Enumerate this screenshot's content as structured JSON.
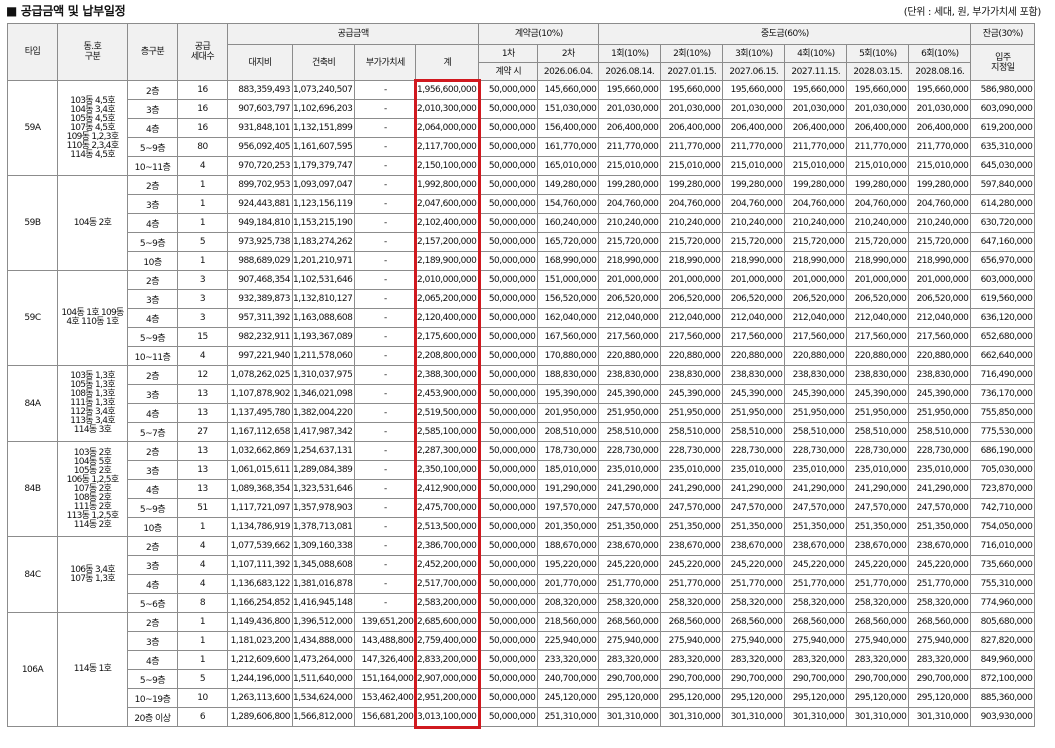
{
  "title": "■ 공급금액 및 납부일정",
  "unit_note": "(단위 : 세대, 원, 부가가치세 포함)",
  "headers": {
    "type": "타입",
    "dong": "동.호\n구분",
    "floor": "층구분",
    "units": "공급\n세대수",
    "supply": "공급금액",
    "land": "대지비",
    "building": "건축비",
    "vat": "부가가치세",
    "total": "계",
    "contract": "계약금(10%)",
    "c1": "1차",
    "c2": "2차",
    "c1_date": "계약 시",
    "c2_date": "2026.06.04.",
    "interim": "중도금(60%)",
    "interim_labels": [
      "1회(10%)",
      "2회(10%)",
      "3회(10%)",
      "4회(10%)",
      "5회(10%)",
      "6회(10%)"
    ],
    "interim_dates": [
      "2026.08.14.",
      "2027.01.15.",
      "2027.06.15.",
      "2027.11.15.",
      "2028.03.15.",
      "2028.08.16."
    ],
    "balance": "잔금(30%)",
    "movein": "입주\n지정일"
  },
  "groups": [
    {
      "type": "59A",
      "dong": "103동 4,5호\n104동 3,4호\n105동 4,5호\n107동 4,5호\n109동 1,2,3호\n110동 2,3,4호\n114동 4,5호",
      "rows": [
        {
          "floor": "2층",
          "units": "16",
          "land": "883,359,493",
          "building": "1,073,240,507",
          "vat": "-",
          "total": "1,956,600,000",
          "c1": "50,000,000",
          "c2": "145,660,000",
          "mid": "195,660,000",
          "bal": "586,980,000"
        },
        {
          "floor": "3층",
          "units": "16",
          "land": "907,603,797",
          "building": "1,102,696,203",
          "vat": "-",
          "total": "2,010,300,000",
          "c1": "50,000,000",
          "c2": "151,030,000",
          "mid": "201,030,000",
          "bal": "603,090,000"
        },
        {
          "floor": "4층",
          "units": "16",
          "land": "931,848,101",
          "building": "1,132,151,899",
          "vat": "-",
          "total": "2,064,000,000",
          "c1": "50,000,000",
          "c2": "156,400,000",
          "mid": "206,400,000",
          "bal": "619,200,000"
        },
        {
          "floor": "5~9층",
          "units": "80",
          "land": "956,092,405",
          "building": "1,161,607,595",
          "vat": "-",
          "total": "2,117,700,000",
          "c1": "50,000,000",
          "c2": "161,770,000",
          "mid": "211,770,000",
          "bal": "635,310,000"
        },
        {
          "floor": "10~11층",
          "units": "4",
          "land": "970,720,253",
          "building": "1,179,379,747",
          "vat": "-",
          "total": "2,150,100,000",
          "c1": "50,000,000",
          "c2": "165,010,000",
          "mid": "215,010,000",
          "bal": "645,030,000"
        }
      ]
    },
    {
      "type": "59B",
      "dong": "104동 2호",
      "rows": [
        {
          "floor": "2층",
          "units": "1",
          "land": "899,702,953",
          "building": "1,093,097,047",
          "vat": "-",
          "total": "1,992,800,000",
          "c1": "50,000,000",
          "c2": "149,280,000",
          "mid": "199,280,000",
          "bal": "597,840,000"
        },
        {
          "floor": "3층",
          "units": "1",
          "land": "924,443,881",
          "building": "1,123,156,119",
          "vat": "-",
          "total": "2,047,600,000",
          "c1": "50,000,000",
          "c2": "154,760,000",
          "mid": "204,760,000",
          "bal": "614,280,000"
        },
        {
          "floor": "4층",
          "units": "1",
          "land": "949,184,810",
          "building": "1,153,215,190",
          "vat": "-",
          "total": "2,102,400,000",
          "c1": "50,000,000",
          "c2": "160,240,000",
          "mid": "210,240,000",
          "bal": "630,720,000"
        },
        {
          "floor": "5~9층",
          "units": "5",
          "land": "973,925,738",
          "building": "1,183,274,262",
          "vat": "-",
          "total": "2,157,200,000",
          "c1": "50,000,000",
          "c2": "165,720,000",
          "mid": "215,720,000",
          "bal": "647,160,000"
        },
        {
          "floor": "10층",
          "units": "1",
          "land": "988,689,029",
          "building": "1,201,210,971",
          "vat": "-",
          "total": "2,189,900,000",
          "c1": "50,000,000",
          "c2": "168,990,000",
          "mid": "218,990,000",
          "bal": "656,970,000"
        }
      ]
    },
    {
      "type": "59C",
      "dong": "104동 1호 109동\n4호 110동 1호",
      "rows": [
        {
          "floor": "2층",
          "units": "3",
          "land": "907,468,354",
          "building": "1,102,531,646",
          "vat": "-",
          "total": "2,010,000,000",
          "c1": "50,000,000",
          "c2": "151,000,000",
          "mid": "201,000,000",
          "bal": "603,000,000"
        },
        {
          "floor": "3층",
          "units": "3",
          "land": "932,389,873",
          "building": "1,132,810,127",
          "vat": "-",
          "total": "2,065,200,000",
          "c1": "50,000,000",
          "c2": "156,520,000",
          "mid": "206,520,000",
          "bal": "619,560,000"
        },
        {
          "floor": "4층",
          "units": "3",
          "land": "957,311,392",
          "building": "1,163,088,608",
          "vat": "-",
          "total": "2,120,400,000",
          "c1": "50,000,000",
          "c2": "162,040,000",
          "mid": "212,040,000",
          "bal": "636,120,000"
        },
        {
          "floor": "5~9층",
          "units": "15",
          "land": "982,232,911",
          "building": "1,193,367,089",
          "vat": "-",
          "total": "2,175,600,000",
          "c1": "50,000,000",
          "c2": "167,560,000",
          "mid": "217,560,000",
          "bal": "652,680,000"
        },
        {
          "floor": "10~11층",
          "units": "4",
          "land": "997,221,940",
          "building": "1,211,578,060",
          "vat": "-",
          "total": "2,208,800,000",
          "c1": "50,000,000",
          "c2": "170,880,000",
          "mid": "220,880,000",
          "bal": "662,640,000"
        }
      ]
    },
    {
      "type": "84A",
      "dong": "103동 1,3호\n105동 1,3호\n108동 1,3호\n111동 1,3호\n112동 3,4호\n113동 3,4호\n114동 3호",
      "rows": [
        {
          "floor": "2층",
          "units": "12",
          "land": "1,078,262,025",
          "building": "1,310,037,975",
          "vat": "-",
          "total": "2,388,300,000",
          "c1": "50,000,000",
          "c2": "188,830,000",
          "mid": "238,830,000",
          "bal": "716,490,000"
        },
        {
          "floor": "3층",
          "units": "13",
          "land": "1,107,878,902",
          "building": "1,346,021,098",
          "vat": "-",
          "total": "2,453,900,000",
          "c1": "50,000,000",
          "c2": "195,390,000",
          "mid": "245,390,000",
          "bal": "736,170,000"
        },
        {
          "floor": "4층",
          "units": "13",
          "land": "1,137,495,780",
          "building": "1,382,004,220",
          "vat": "-",
          "total": "2,519,500,000",
          "c1": "50,000,000",
          "c2": "201,950,000",
          "mid": "251,950,000",
          "bal": "755,850,000"
        },
        {
          "floor": "5~7층",
          "units": "27",
          "land": "1,167,112,658",
          "building": "1,417,987,342",
          "vat": "-",
          "total": "2,585,100,000",
          "c1": "50,000,000",
          "c2": "208,510,000",
          "mid": "258,510,000",
          "bal": "775,530,000"
        }
      ]
    },
    {
      "type": "84B",
      "dong": "103동 2호\n104동 5호\n105동 2호\n106동 1,2,5호\n107동 2호\n108동 2호\n111동 2호\n113동 1,2,5호\n114동 2호",
      "rows": [
        {
          "floor": "2층",
          "units": "13",
          "land": "1,032,662,869",
          "building": "1,254,637,131",
          "vat": "-",
          "total": "2,287,300,000",
          "c1": "50,000,000",
          "c2": "178,730,000",
          "mid": "228,730,000",
          "bal": "686,190,000"
        },
        {
          "floor": "3층",
          "units": "13",
          "land": "1,061,015,611",
          "building": "1,289,084,389",
          "vat": "-",
          "total": "2,350,100,000",
          "c1": "50,000,000",
          "c2": "185,010,000",
          "mid": "235,010,000",
          "bal": "705,030,000"
        },
        {
          "floor": "4층",
          "units": "13",
          "land": "1,089,368,354",
          "building": "1,323,531,646",
          "vat": "-",
          "total": "2,412,900,000",
          "c1": "50,000,000",
          "c2": "191,290,000",
          "mid": "241,290,000",
          "bal": "723,870,000"
        },
        {
          "floor": "5~9층",
          "units": "51",
          "land": "1,117,721,097",
          "building": "1,357,978,903",
          "vat": "-",
          "total": "2,475,700,000",
          "c1": "50,000,000",
          "c2": "197,570,000",
          "mid": "247,570,000",
          "bal": "742,710,000"
        },
        {
          "floor": "10층",
          "units": "1",
          "land": "1,134,786,919",
          "building": "1,378,713,081",
          "vat": "-",
          "total": "2,513,500,000",
          "c1": "50,000,000",
          "c2": "201,350,000",
          "mid": "251,350,000",
          "bal": "754,050,000"
        }
      ]
    },
    {
      "type": "84C",
      "dong": "106동 3,4호\n107동 1,3호",
      "rows": [
        {
          "floor": "2층",
          "units": "4",
          "land": "1,077,539,662",
          "building": "1,309,160,338",
          "vat": "-",
          "total": "2,386,700,000",
          "c1": "50,000,000",
          "c2": "188,670,000",
          "mid": "238,670,000",
          "bal": "716,010,000"
        },
        {
          "floor": "3층",
          "units": "4",
          "land": "1,107,111,392",
          "building": "1,345,088,608",
          "vat": "-",
          "total": "2,452,200,000",
          "c1": "50,000,000",
          "c2": "195,220,000",
          "mid": "245,220,000",
          "bal": "735,660,000"
        },
        {
          "floor": "4층",
          "units": "4",
          "land": "1,136,683,122",
          "building": "1,381,016,878",
          "vat": "-",
          "total": "2,517,700,000",
          "c1": "50,000,000",
          "c2": "201,770,000",
          "mid": "251,770,000",
          "bal": "755,310,000"
        },
        {
          "floor": "5~6층",
          "units": "8",
          "land": "1,166,254,852",
          "building": "1,416,945,148",
          "vat": "-",
          "total": "2,583,200,000",
          "c1": "50,000,000",
          "c2": "208,320,000",
          "mid": "258,320,000",
          "bal": "774,960,000"
        }
      ]
    },
    {
      "type": "106A",
      "dong": "114동 1호",
      "rows": [
        {
          "floor": "2층",
          "units": "1",
          "land": "1,149,436,800",
          "building": "1,396,512,000",
          "vat": "139,651,200",
          "total": "2,685,600,000",
          "c1": "50,000,000",
          "c2": "218,560,000",
          "mid": "268,560,000",
          "bal": "805,680,000"
        },
        {
          "floor": "3층",
          "units": "1",
          "land": "1,181,023,200",
          "building": "1,434,888,000",
          "vat": "143,488,800",
          "total": "2,759,400,000",
          "c1": "50,000,000",
          "c2": "225,940,000",
          "mid": "275,940,000",
          "bal": "827,820,000"
        },
        {
          "floor": "4층",
          "units": "1",
          "land": "1,212,609,600",
          "building": "1,473,264,000",
          "vat": "147,326,400",
          "total": "2,833,200,000",
          "c1": "50,000,000",
          "c2": "233,320,000",
          "mid": "283,320,000",
          "bal": "849,960,000"
        },
        {
          "floor": "5~9층",
          "units": "5",
          "land": "1,244,196,000",
          "building": "1,511,640,000",
          "vat": "151,164,000",
          "total": "2,907,000,000",
          "c1": "50,000,000",
          "c2": "240,700,000",
          "mid": "290,700,000",
          "bal": "872,100,000"
        },
        {
          "floor": "10~19층",
          "units": "10",
          "land": "1,263,113,600",
          "building": "1,534,624,000",
          "vat": "153,462,400",
          "total": "2,951,200,000",
          "c1": "50,000,000",
          "c2": "245,120,000",
          "mid": "295,120,000",
          "bal": "885,360,000"
        },
        {
          "floor": "20층 이상",
          "units": "6",
          "land": "1,289,606,800",
          "building": "1,566,812,000",
          "vat": "156,681,200",
          "total": "3,013,100,000",
          "c1": "50,000,000",
          "c2": "251,310,000",
          "mid": "301,310,000",
          "bal": "903,930,000"
        }
      ]
    }
  ],
  "highlight_color": "#d0191f"
}
